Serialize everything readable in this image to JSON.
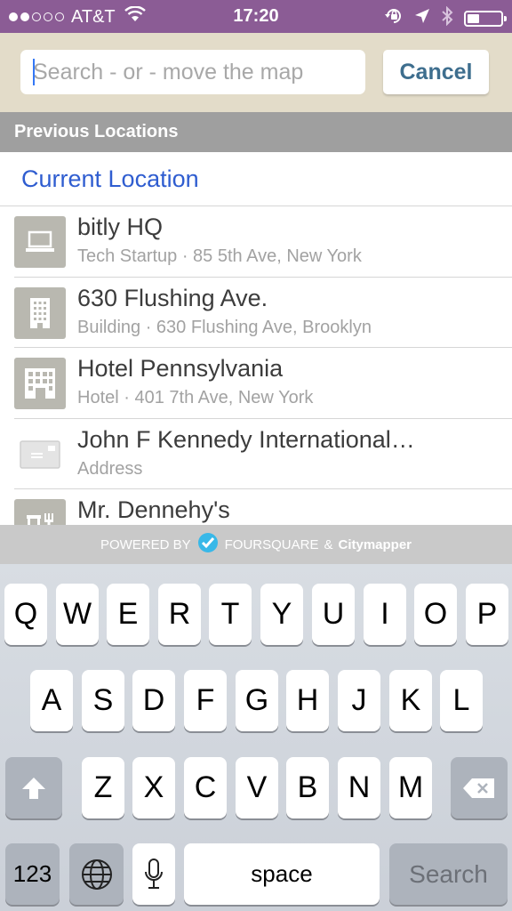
{
  "status_bar": {
    "carrier": "AT&T",
    "time": "17:20",
    "signal_filled": 2,
    "signal_total": 5,
    "battery_level": 0.35,
    "icons": [
      "wifi-icon",
      "rotation-lock-icon",
      "location-arrow-icon",
      "bluetooth-icon",
      "battery-icon"
    ]
  },
  "search": {
    "placeholder": "Search - or - move the map",
    "value": "",
    "cancel_label": "Cancel"
  },
  "section_header": "Previous Locations",
  "current_location_label": "Current Location",
  "locations": [
    {
      "title": "bitly HQ",
      "subtitle": "Tech Startup · 85 5th Ave, New York",
      "icon": "laptop-icon"
    },
    {
      "title": "630 Flushing Ave.",
      "subtitle": "Building · 630 Flushing Ave, Brooklyn",
      "icon": "building-icon"
    },
    {
      "title": "Hotel Pennsylvania",
      "subtitle": "Hotel · 401 7th Ave, New York",
      "icon": "hotel-icon"
    },
    {
      "title": "John F Kennedy International…",
      "subtitle": "Address",
      "icon": "address-card-icon"
    },
    {
      "title": "Mr. Dennehy's",
      "subtitle": "",
      "icon": "restaurant-icon"
    }
  ],
  "powered_by": {
    "prefix": "POWERED BY",
    "brand1": "FOURSQUARE",
    "joiner": "&",
    "brand2": "Citymapper"
  },
  "keyboard": {
    "row1": [
      "Q",
      "W",
      "E",
      "R",
      "T",
      "Y",
      "U",
      "I",
      "O",
      "P"
    ],
    "row2": [
      "A",
      "S",
      "D",
      "F",
      "G",
      "H",
      "J",
      "K",
      "L"
    ],
    "row3": [
      "Z",
      "X",
      "C",
      "V",
      "B",
      "N",
      "M"
    ],
    "numbers_label": "123",
    "space_label": "space",
    "search_label": "Search"
  },
  "colors": {
    "status_bar": "#8b5c95",
    "header_bg": "#e3dcc9",
    "accent_blue": "#2f5dd0",
    "cancel_text": "#3e6e8e",
    "foursquare": "#38b8e8"
  }
}
